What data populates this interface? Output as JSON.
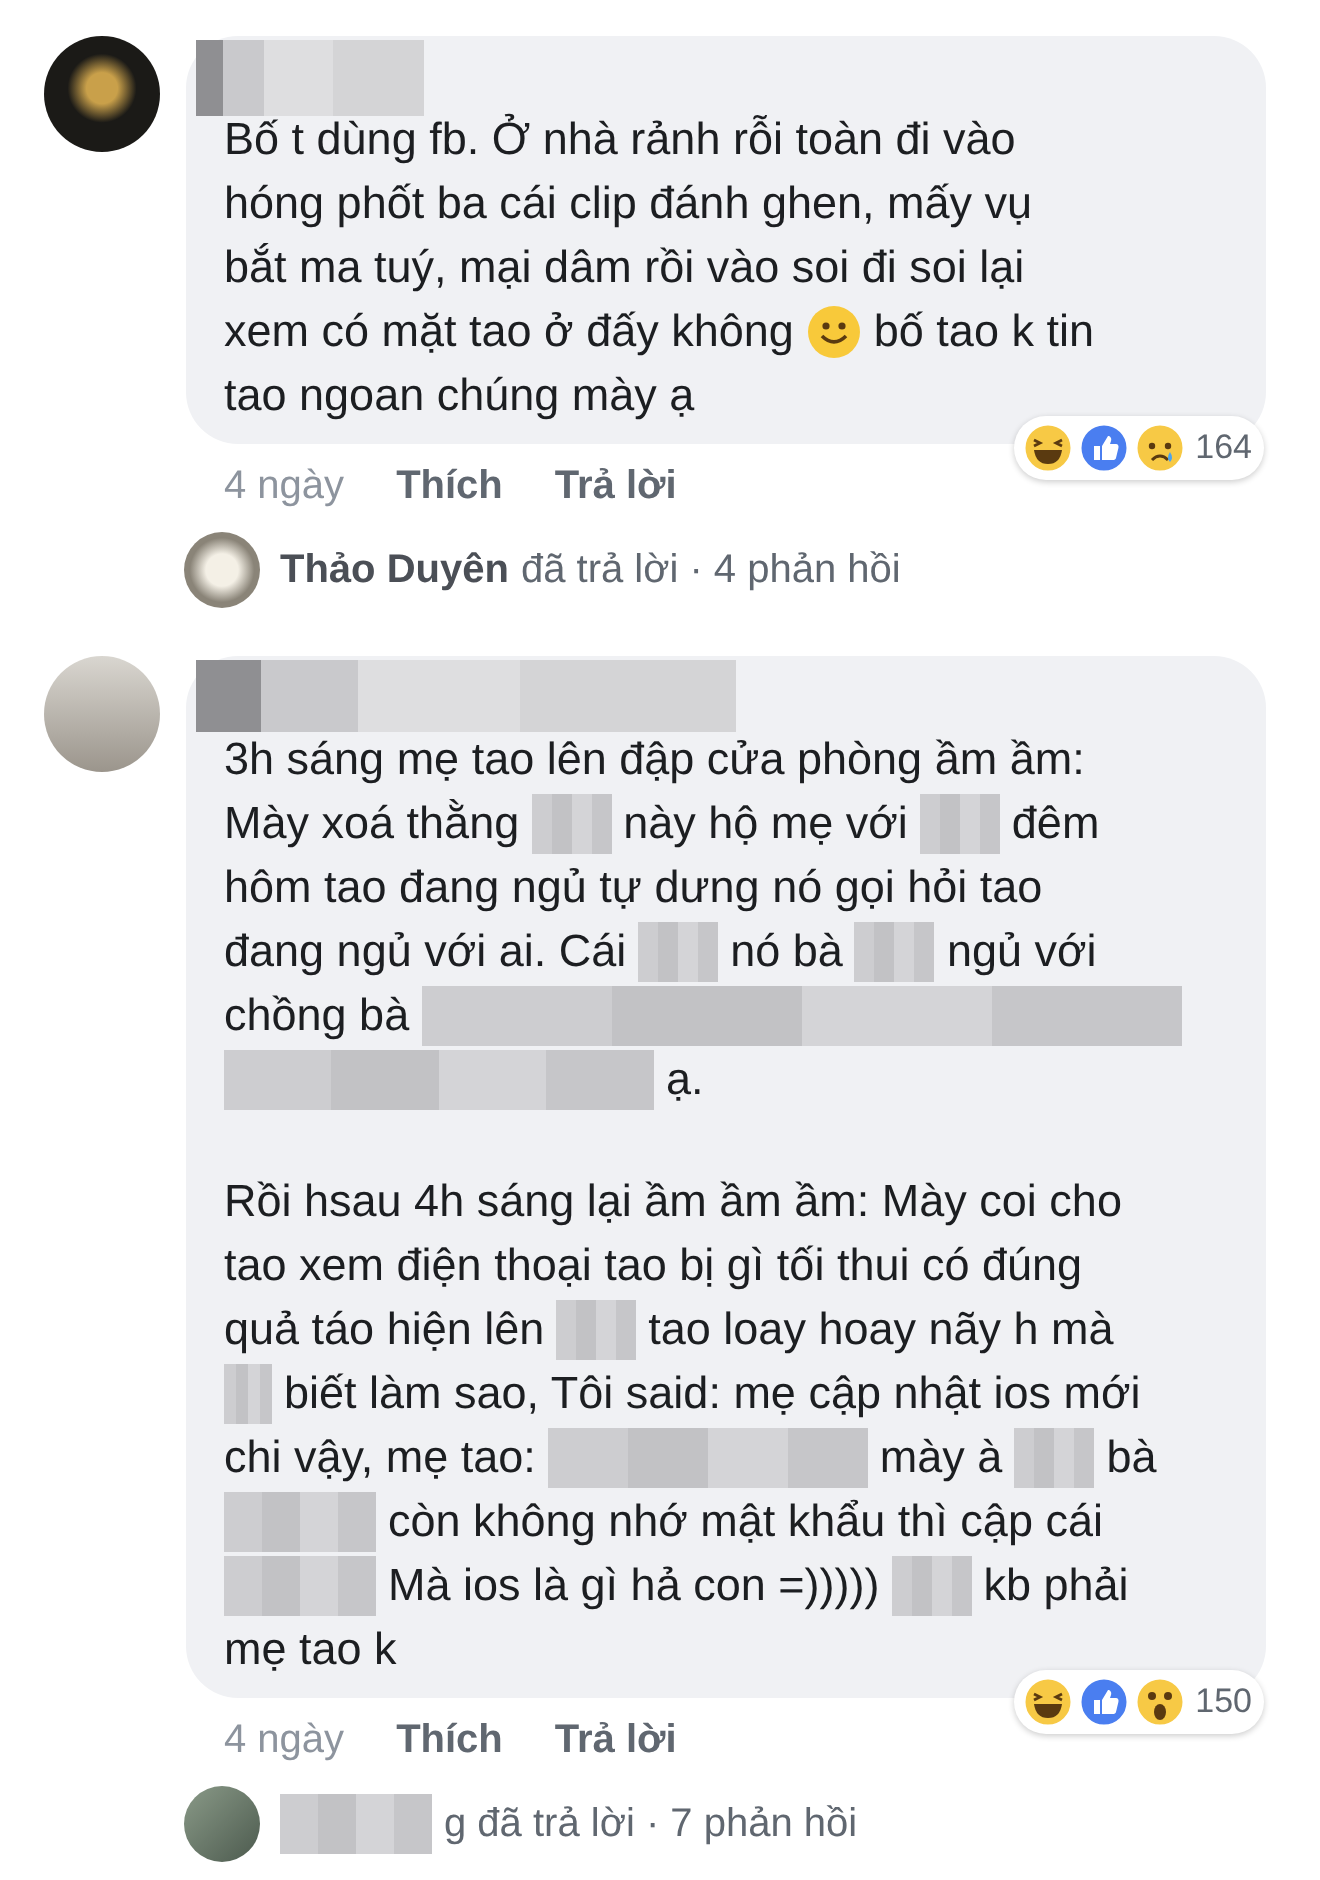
{
  "comments": [
    {
      "author": {
        "kind": "short"
      },
      "paragraphs": [
        [
          [
            {
              "kind": "text",
              "text": "Bố t dùng fb. Ở nhà rảnh rỗi toàn đi vào"
            }
          ],
          [
            {
              "kind": "text",
              "text": "hóng phốt ba cái clip đánh ghen, mấy vụ"
            }
          ],
          [
            {
              "kind": "text",
              "text": "bắt ma tuý, mại dâm rồi vào soi đi soi lại"
            }
          ],
          [
            {
              "kind": "text",
              "text": "xem có mặt tao ở đấy không"
            },
            {
              "kind": "smile"
            },
            {
              "kind": "text",
              "text": "bố tao k tin"
            }
          ],
          [
            {
              "kind": "text",
              "text": "tao ngoan chúng mày ạ"
            }
          ]
        ]
      ],
      "time": "4 ngày",
      "like": "Thích",
      "reply": "Trả lời",
      "reactions": {
        "icons": [
          {
            "kind": "haha"
          },
          {
            "kind": "like"
          },
          {
            "kind": "sad"
          }
        ],
        "count": "164"
      },
      "replies": {
        "segments": [
          {
            "kind": "name",
            "text": "Thảo Duyên"
          },
          {
            "kind": "text",
            "text": "đã trả lời · 4 phản hồi"
          }
        ]
      }
    },
    {
      "author": {
        "kind": "wide"
      },
      "paragraphs": [
        [
          [
            {
              "kind": "text",
              "text": "3h sáng mẹ tao lên đập cửa phòng ầm ầm:"
            }
          ],
          [
            {
              "kind": "text",
              "text": "Mày xoá thằng"
            },
            {
              "kind": "short"
            },
            {
              "kind": "text",
              "text": "này hộ mẹ với"
            },
            {
              "kind": "short"
            },
            {
              "kind": "text",
              "text": "đêm"
            }
          ],
          [
            {
              "kind": "text",
              "text": "hôm tao đang ngủ tự dưng nó gọi hỏi tao"
            }
          ],
          [
            {
              "kind": "text",
              "text": "đang ngủ với ai. Cái"
            },
            {
              "kind": "short"
            },
            {
              "kind": "text",
              "text": "nó bà"
            },
            {
              "kind": "short"
            },
            {
              "kind": "text",
              "text": "ngủ với"
            }
          ],
          [
            {
              "kind": "text",
              "text": "chồng bà"
            },
            {
              "kind": "widest"
            }
          ],
          [
            {
              "kind": "wider"
            },
            {
              "kind": "text",
              "text": "ạ."
            }
          ]
        ],
        [
          [
            {
              "kind": "text",
              "text": "Rồi hsau 4h sáng lại ầm ầm ầm: Mày coi cho"
            }
          ],
          [
            {
              "kind": "text",
              "text": "tao xem điện thoại tao bị gì tối thui có đúng"
            }
          ],
          [
            {
              "kind": "text",
              "text": "quả táo hiện lên"
            },
            {
              "kind": "short"
            },
            {
              "kind": "text",
              "text": "tao loay hoay nãy h mà"
            }
          ],
          [
            {
              "kind": "tiny"
            },
            {
              "kind": "text",
              "text": "biết làm sao, Tôi said: mẹ cập nhật ios mới"
            }
          ],
          [
            {
              "kind": "text",
              "text": "chi vậy, mẹ tao:"
            },
            {
              "kind": "long"
            },
            {
              "kind": "text",
              "text": "mày à"
            },
            {
              "kind": "short"
            },
            {
              "kind": "text",
              "text": "bà"
            }
          ],
          [
            {
              "kind": "medium"
            },
            {
              "kind": "text",
              "text": "còn không nhớ mật khẩu thì cập cái"
            }
          ],
          [
            {
              "kind": "medium"
            },
            {
              "kind": "text",
              "text": "Mà ios là gì hả con =)))))"
            },
            {
              "kind": "short"
            },
            {
              "kind": "text",
              "text": "kb phải"
            }
          ],
          [
            {
              "kind": "text",
              "text": "mẹ tao k"
            }
          ]
        ]
      ],
      "time": "4 ngày",
      "like": "Thích",
      "reply": "Trả lời",
      "reactions": {
        "icons": [
          {
            "kind": "haha"
          },
          {
            "kind": "like"
          },
          {
            "kind": "wow"
          }
        ],
        "count": "150"
      },
      "replies": {
        "segments": [
          {
            "kind": "medium"
          },
          {
            "kind": "text",
            "text": "g đã trả lời · 7 phản hồi"
          }
        ]
      }
    }
  ]
}
